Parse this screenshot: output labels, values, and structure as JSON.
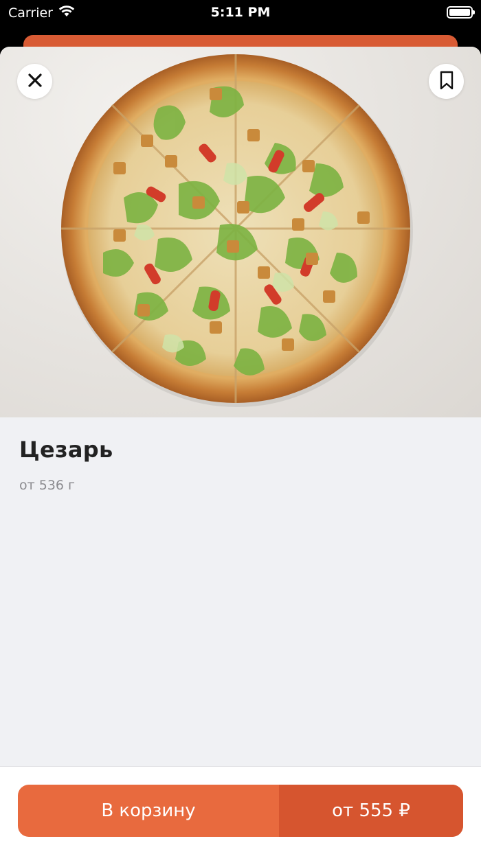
{
  "status_bar": {
    "carrier": "Carrier",
    "time": "5:11 PM",
    "wifi_icon": "wifi-icon",
    "battery_icon": "battery-icon"
  },
  "product": {
    "name": "Цезарь",
    "weight": "от 536 г",
    "image_alt": "pizza-photo"
  },
  "actions": {
    "close_icon": "close-icon",
    "bookmark_icon": "bookmark-icon",
    "add_to_cart_label": "В корзину",
    "price_label": "от 555 ₽"
  },
  "colors": {
    "accent": "#e86a3e",
    "accent_dark": "#d6552f",
    "background": "#f0f1f4"
  }
}
